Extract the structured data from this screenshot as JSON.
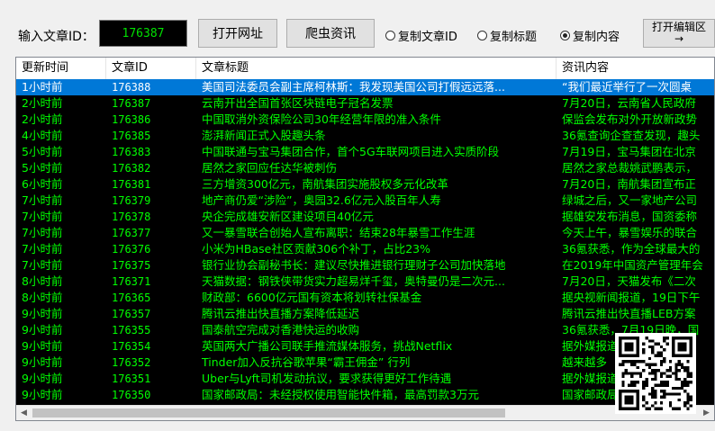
{
  "toolbar": {
    "id_label": "输入文章ID：",
    "id_value": "176387",
    "open_url_button": "打开网址",
    "crawl_button": "爬虫资讯",
    "radios": [
      {
        "label": "复制文章ID",
        "checked": false
      },
      {
        "label": "复制标题",
        "checked": false
      },
      {
        "label": "复制内容",
        "checked": true
      }
    ],
    "editor_button_line1": "打开编辑区",
    "editor_button_arrow": "→"
  },
  "table": {
    "columns": [
      "更新时间",
      "文章ID",
      "文章标题",
      "资讯内容"
    ],
    "rows": [
      {
        "time": "1小时前",
        "id": "176388",
        "title": "美国司法委员会副主席柯林斯：我发现美国公司打假远远落...",
        "content": "“我们最近举行了一次圆桌",
        "selected": true
      },
      {
        "time": "2小时前",
        "id": "176387",
        "title": "云南开出全国首张区块链电子冠名发票",
        "content": "7月20日，云南省人民政府"
      },
      {
        "time": "2小时前",
        "id": "176386",
        "title": "中国取消外资保险公司30年经营年限的准入条件",
        "content": "保监会发布对外开放新政势"
      },
      {
        "time": "4小时前",
        "id": "176385",
        "title": "澎湃新闻正式入股趣头条",
        "content": "36氪查询企查查发现，趣头"
      },
      {
        "time": "5小时前",
        "id": "176383",
        "title": "中国联通与宝马集团合作，首个5G车联网项目进入实质阶段",
        "content": "7月19日，宝马集团在北京"
      },
      {
        "time": "5小时前",
        "id": "176382",
        "title": "居然之家回应任达华被刺伤",
        "content": "居然之家总裁姚武鹏表示，"
      },
      {
        "time": "6小时前",
        "id": "176381",
        "title": "三方增资300亿元，南航集团实施股权多元化改革",
        "content": "7月20日，南航集团宣布正"
      },
      {
        "time": "7小时前",
        "id": "176379",
        "title": "地产商仍爱“涉险”，奥园32.6亿元入股百年人寿",
        "content": "绿城之后，又一家地产公司"
      },
      {
        "time": "7小时前",
        "id": "176378",
        "title": "央企完成雄安新区建设项目40亿元",
        "content": "据雄安发布消息，国资委称"
      },
      {
        "time": "7小时前",
        "id": "176377",
        "title": "又一暴雪联合创始人宣布离职：结束28年暴雪工作生涯",
        "content": "今天上午，暴雪娱乐的联合"
      },
      {
        "time": "7小时前",
        "id": "176376",
        "title": "小米为HBase社区贡献306个补丁，占比23%",
        "content": "36氪获悉，作为全球最大的"
      },
      {
        "time": "7小时前",
        "id": "176375",
        "title": "银行业协会副秘书长：建议尽快推进银行理财子公司加快落地",
        "content": "在2019年中国资产管理年会"
      },
      {
        "time": "8小时前",
        "id": "176371",
        "title": "天猫数据：钢铁侠带货实力超易烊千玺，奥特曼仍是二次元...",
        "content": "7月20日，天猫发布《二次"
      },
      {
        "time": "8小时前",
        "id": "176365",
        "title": "财政部：6600亿元国有资本将划转社保基金",
        "content": "据央视新闻报道，19日下午"
      },
      {
        "time": "9小时前",
        "id": "176357",
        "title": "腾讯云推出快直播方案降低延迟",
        "content": "腾讯云推出快直播LEB方案"
      },
      {
        "time": "9小时前",
        "id": "176355",
        "title": "国泰航空完成对香港快运的收购",
        "content": "36氪获悉，7月19日晚，国"
      },
      {
        "time": "9小时前",
        "id": "176354",
        "title": "英国两大广播公司联手推流媒体服务，挑战Netflix",
        "content": "据外媒报道，"
      },
      {
        "time": "9小时前",
        "id": "176352",
        "title": "Tinder加入反抗谷歌苹果“霸王佣金” 行列",
        "content": "越来越多"
      },
      {
        "time": "9小时前",
        "id": "176351",
        "title": "Uber与Lyft司机发动抗议，要求获得更好工作待遇",
        "content": "据外媒报道"
      },
      {
        "time": "9小时前",
        "id": "176350",
        "title": "国家邮政局：未经授权使用智能快件箱，最高罚款3万元",
        "content": "国家邮政局《"
      }
    ]
  }
}
